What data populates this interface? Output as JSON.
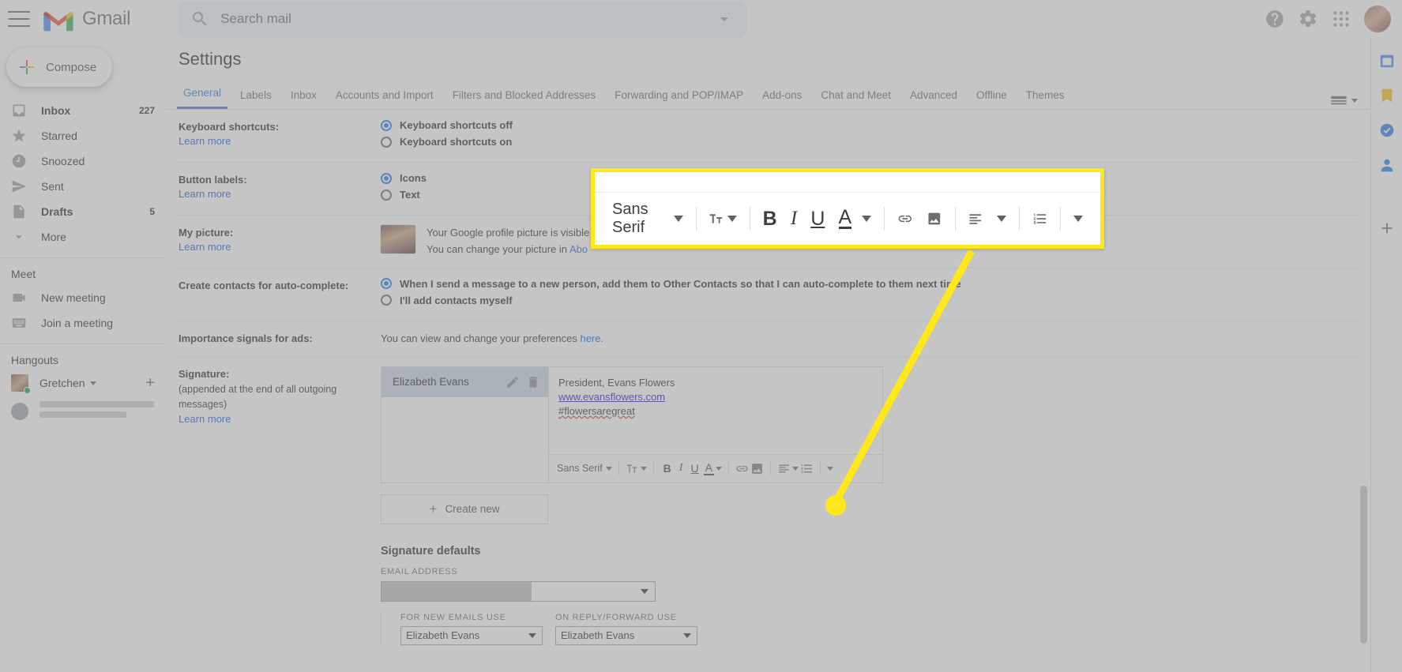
{
  "app": {
    "name": "Gmail",
    "menu_icon": "hamburger-icon"
  },
  "search": {
    "placeholder": "Search mail",
    "value": "",
    "icon": "search-icon",
    "options_icon": "chevron-down-icon"
  },
  "topbar": {
    "help_icon": "help-icon",
    "settings_icon": "gear-icon",
    "apps_icon": "apps-grid-icon",
    "avatar": "user-avatar"
  },
  "sidebar": {
    "compose_label": "Compose",
    "items": [
      {
        "label": "Inbox",
        "count": "227",
        "icon": "inbox-icon",
        "bold": true
      },
      {
        "label": "Starred",
        "count": "",
        "icon": "star-icon",
        "bold": false
      },
      {
        "label": "Snoozed",
        "count": "",
        "icon": "clock-icon",
        "bold": false
      },
      {
        "label": "Sent",
        "count": "",
        "icon": "send-icon",
        "bold": false
      },
      {
        "label": "Drafts",
        "count": "5",
        "icon": "draft-icon",
        "bold": true
      },
      {
        "label": "More",
        "count": "",
        "icon": "chevron-down-icon",
        "bold": false
      }
    ],
    "meet_title": "Meet",
    "meet_items": [
      {
        "label": "New meeting",
        "icon": "video-camera-icon"
      },
      {
        "label": "Join a meeting",
        "icon": "keyboard-icon"
      }
    ],
    "hangouts_title": "Hangouts",
    "hangouts_user": "Gretchen",
    "hangouts_add_icon": "plus-icon"
  },
  "settings": {
    "title": "Settings",
    "density_icon": "display-density-icon",
    "tabs": [
      {
        "label": "General",
        "active": true
      },
      {
        "label": "Labels",
        "active": false
      },
      {
        "label": "Inbox",
        "active": false
      },
      {
        "label": "Accounts and Import",
        "active": false
      },
      {
        "label": "Filters and Blocked Addresses",
        "active": false
      },
      {
        "label": "Forwarding and POP/IMAP",
        "active": false
      },
      {
        "label": "Add-ons",
        "active": false
      },
      {
        "label": "Chat and Meet",
        "active": false
      },
      {
        "label": "Advanced",
        "active": false
      },
      {
        "label": "Offline",
        "active": false
      },
      {
        "label": "Themes",
        "active": false
      }
    ],
    "keyboard_shortcuts": {
      "label": "Keyboard shortcuts:",
      "learn_more": "Learn more",
      "options": [
        {
          "label": "Keyboard shortcuts off",
          "selected": true
        },
        {
          "label": "Keyboard shortcuts on",
          "selected": false
        }
      ]
    },
    "button_labels": {
      "label": "Button labels:",
      "learn_more": "Learn more",
      "options": [
        {
          "label": "Icons",
          "selected": true
        },
        {
          "label": "Text",
          "selected": false
        }
      ]
    },
    "my_picture": {
      "label": "My picture:",
      "learn_more": "Learn more",
      "line1": "Your Google profile picture is visible",
      "line2_pre": "You can change your picture in ",
      "line2_link": "Abo"
    },
    "auto_complete": {
      "label": "Create contacts for auto-complete:",
      "options": [
        {
          "label": "When I send a message to a new person, add them to Other Contacts so that I can auto-complete to them next time",
          "selected": true
        },
        {
          "label": "I'll add contacts myself",
          "selected": false
        }
      ]
    },
    "importance_signals": {
      "label": "Importance signals for ads:",
      "text_pre": "You can view and change your preferences ",
      "link": "here",
      "text_post": "."
    },
    "signature": {
      "label": "Signature:",
      "sub": "(appended at the end of all outgoing messages)",
      "learn_more": "Learn more",
      "item_name": "Elizabeth Evans",
      "edit_icon": "pencil-icon",
      "delete_icon": "trash-icon",
      "body_line1": "President, Evans Flowers",
      "body_link": "www.evansflowers.com",
      "body_line3": "#flowersaregreat",
      "create_new": "Create new",
      "create_new_icon": "plus-icon",
      "toolbar": {
        "font": "Sans Serif",
        "size_icon": "font-size-icon",
        "bold": "B",
        "italic": "I",
        "underline": "U",
        "text_color": "A",
        "link_icon": "link-icon",
        "image_icon": "insert-image-icon",
        "align_icon": "align-left-icon",
        "list_icon": "numbered-list-icon",
        "more_icon": "chevron-down-icon"
      }
    },
    "signature_defaults": {
      "title": "Signature defaults",
      "email_address_label": "EMAIL ADDRESS",
      "email_address_value": "",
      "for_new_emails_label": "FOR NEW EMAILS USE",
      "for_new_emails_value": "Elizabeth Evans",
      "on_reply_label": "ON REPLY/FORWARD USE",
      "on_reply_value": "Elizabeth Evans"
    }
  },
  "callout": {
    "border_color": "#ffe81a",
    "toolbar": {
      "font": "Sans Serif",
      "font_caret_icon": "chevron-down-icon",
      "size_icon": "font-size-icon",
      "size_caret_icon": "chevron-down-icon",
      "bold": "B",
      "italic": "I",
      "underline": "U",
      "text_color": "A",
      "color_caret_icon": "chevron-down-icon",
      "link_icon": "link-icon",
      "image_icon": "insert-image-icon",
      "align_icon": "align-left-icon",
      "align_caret_icon": "chevron-down-icon",
      "list_icon": "numbered-list-icon",
      "more_icon": "chevron-down-icon"
    }
  },
  "colors": {
    "accent_blue": "#1a73e8",
    "link_blue": "#1155cc",
    "highlight_yellow": "#ffe81a",
    "text_primary": "#202124",
    "text_secondary": "#5f6368"
  }
}
